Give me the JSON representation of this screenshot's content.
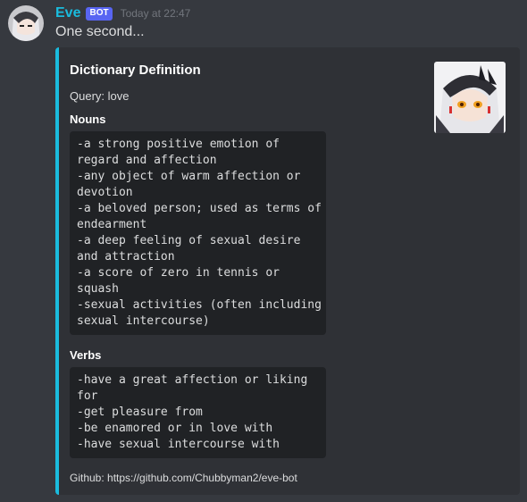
{
  "message": {
    "author": "Eve",
    "bot_tag": "BOT",
    "timestamp": "Today at 22:47",
    "content": "One second..."
  },
  "embed": {
    "accent_color": "#1abcde",
    "title": "Dictionary Definition",
    "description": "Query: love",
    "fields": [
      {
        "name": "Nouns",
        "lines": [
          "-a strong positive emotion of",
          "regard and affection",
          "-any object of warm affection or",
          "devotion",
          "-a beloved person; used as terms of",
          "endearment",
          "-a deep feeling of sexual desire",
          "and attraction",
          "-a score of zero in tennis or",
          "squash",
          "-sexual activities (often including",
          "sexual intercourse)"
        ]
      },
      {
        "name": "Verbs",
        "lines": [
          "-have a great affection or liking",
          "for",
          "-get pleasure from",
          "-be enamored or in love with",
          "-have sexual intercourse with"
        ]
      }
    ],
    "footer": "Github: https://github.com/Chubbyman2/eve-bot",
    "thumbnail_icon": "anime-character-thumbnail"
  },
  "avatar_icon": "anime-character-avatar"
}
